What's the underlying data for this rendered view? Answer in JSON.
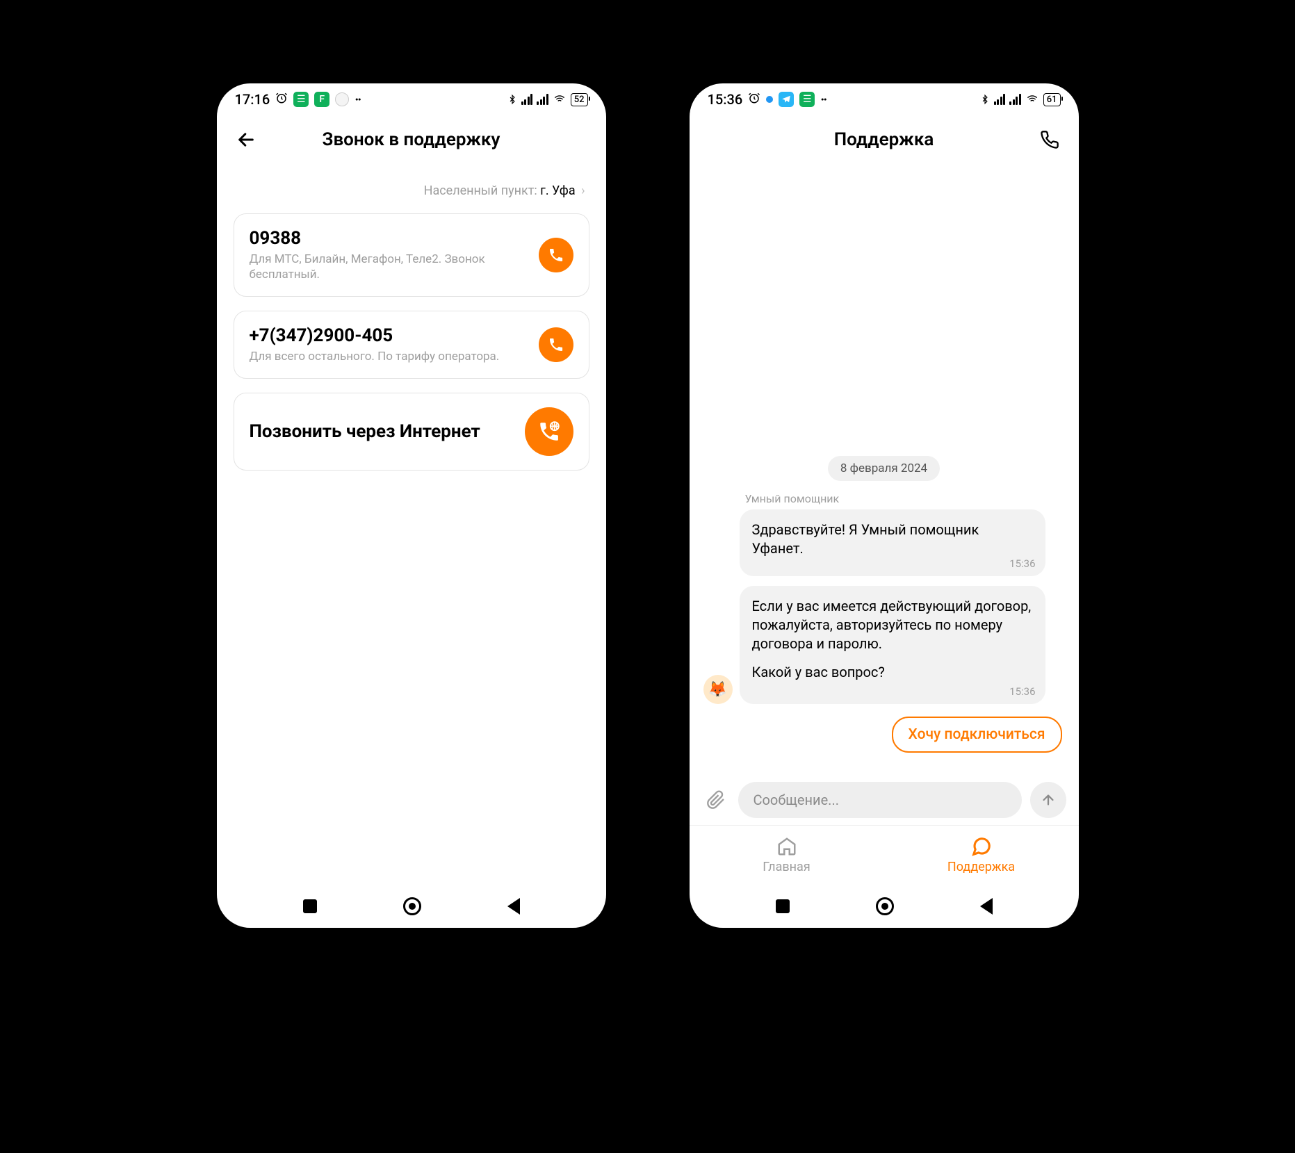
{
  "screen1": {
    "status": {
      "time": "17:16",
      "battery": "52"
    },
    "header": {
      "title": "Звонок в поддержку"
    },
    "locality": {
      "label": "Населенный пункт:",
      "city": "г. Уфа"
    },
    "cards": [
      {
        "number": "09388",
        "sub": "Для МТС, Билайн, Мегафон, Теле2. Звонок бесплатный."
      },
      {
        "number": "+7(347)2900-405",
        "sub": "Для всего остального. По тарифу оператора."
      }
    ],
    "internet_call": "Позвонить через Интернет"
  },
  "screen2": {
    "status": {
      "time": "15:36",
      "battery": "61"
    },
    "header": {
      "title": "Поддержка"
    },
    "date": "8 февраля 2024",
    "sender": "Умный помощник",
    "msg1": {
      "text": "Здравствуйте! Я Умный помощник Уфанет.",
      "time": "15:36"
    },
    "msg2": {
      "p1": "Если у вас имеется действующий договор, пожалуйста, авторизуйтесь по номеру договора и паролю.",
      "p2": "Какой у вас вопрос?",
      "time": "15:36"
    },
    "quick_reply": "Хочу подключиться",
    "composer_placeholder": "Сообщение...",
    "tabs": {
      "home": "Главная",
      "support": "Поддержка"
    }
  }
}
